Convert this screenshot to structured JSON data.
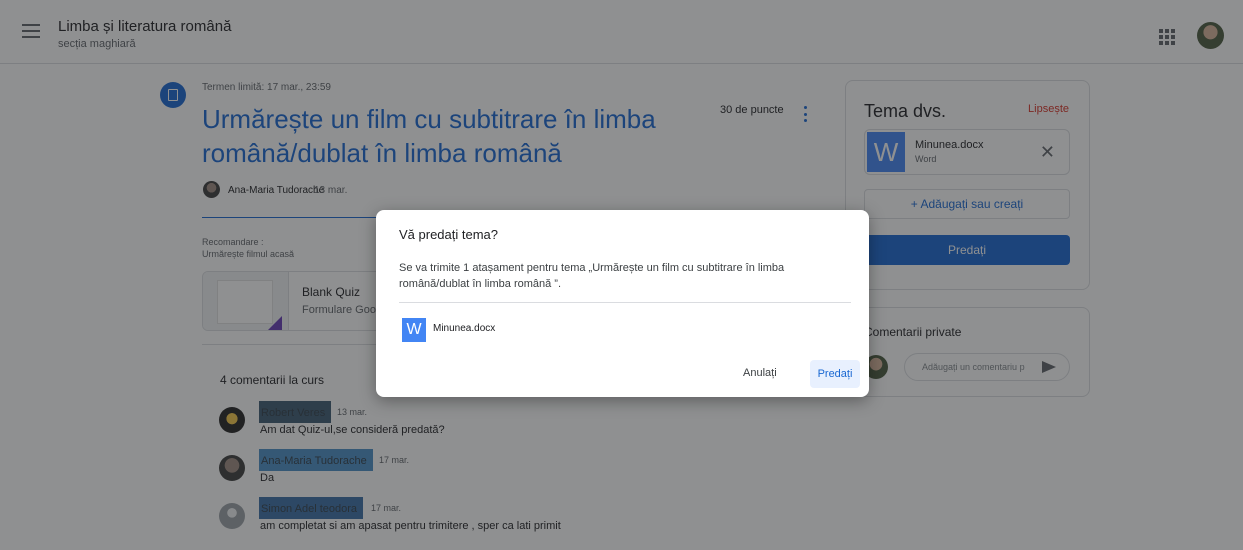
{
  "header": {
    "course_title": "Limba și literatura română",
    "course_section": "secția maghiară",
    "icons": [
      "menu-icon",
      "apps-icon",
      "avatar"
    ]
  },
  "assignment": {
    "deadline": "Termen limită: 17 mar., 23:59",
    "title": "Urmărește un film cu subtitrare în limba română/dublat în limba română",
    "points": "30 de puncte",
    "author": "Ana-Maria Tudorache",
    "posted_date": "13 mar.",
    "instructions_label": "Recomandare :",
    "instructions_text": "Urmărește filmul acasă",
    "attachment": {
      "name": "Blank Quiz",
      "type": "Formulare Goo"
    }
  },
  "class_comments": {
    "count_label": "4 comentarii la curs",
    "items": [
      {
        "author": "Robert Veres",
        "date": "13 mar.",
        "text": "Am dat Quiz-ul,se consideră predată?"
      },
      {
        "author": "Ana-Maria Tudorache",
        "date": "17 mar.",
        "text": "Da"
      },
      {
        "author": "Simon Adel teodora",
        "date": "17 mar.",
        "text": "am completat si am apasat pentru trimitere , sper ca lati primit"
      }
    ]
  },
  "your_work": {
    "title": "Tema dvs.",
    "status": "Lipsește",
    "file": {
      "icon_letter": "W",
      "name": "Minunea.docx",
      "type": "Word"
    },
    "add_label": "+ Adăugați sau creați",
    "submit_label": "Predați"
  },
  "private_comments": {
    "title": "Comentarii private",
    "placeholder": "Adăugați un comentariu p"
  },
  "dialog": {
    "title": "Vă predați tema?",
    "body": "Se va trimite 1 atașament pentru tema „Urmărește un film cu subtitrare în limba română/dublat în limba română ”.",
    "file": {
      "icon_letter": "W",
      "name": "Minunea.docx"
    },
    "cancel_label": "Anulați",
    "submit_label": "Predați"
  },
  "colors": {
    "primary": "#1967d2",
    "status_missing": "#d93025",
    "word_blue": "#4285f4"
  }
}
